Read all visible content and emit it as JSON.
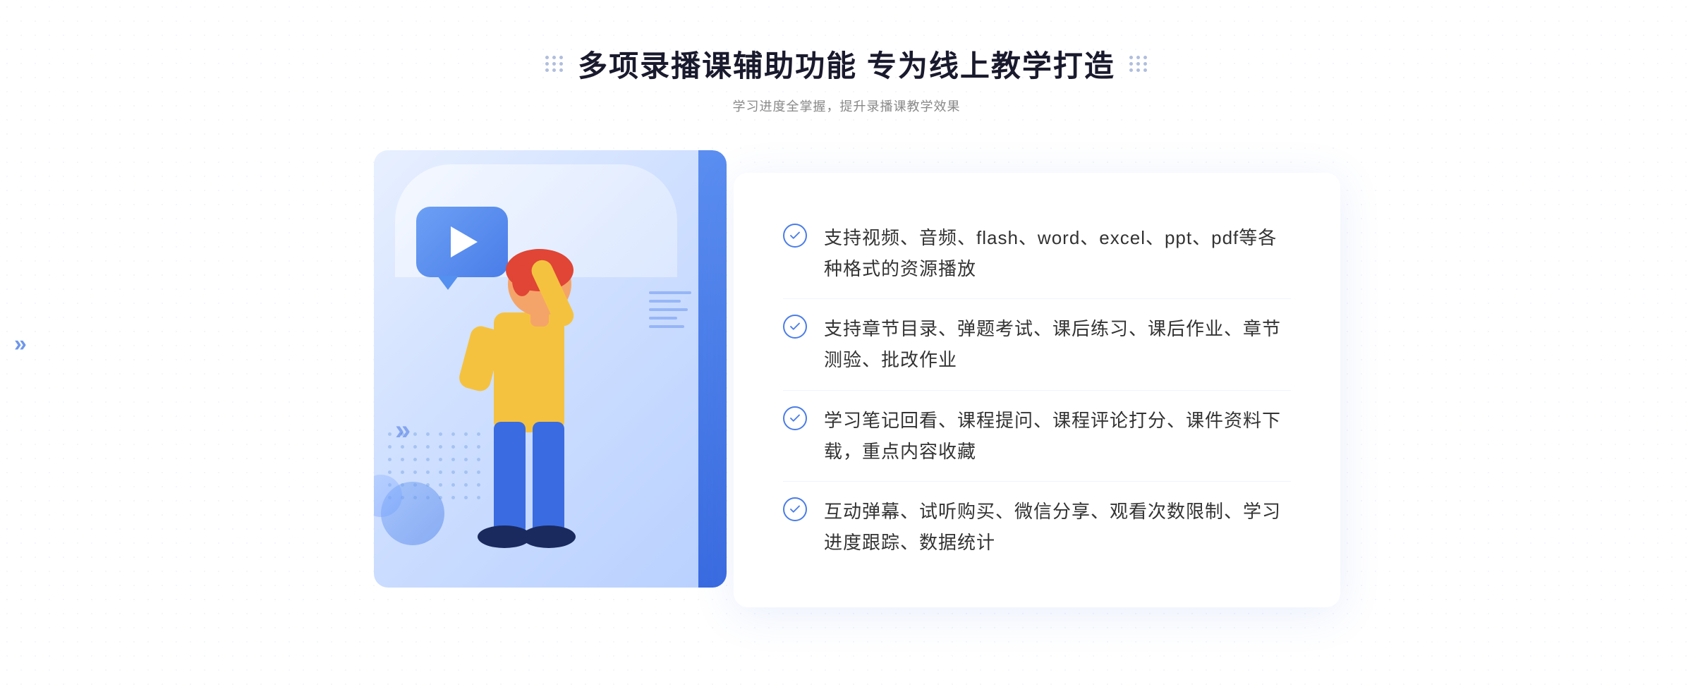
{
  "header": {
    "main_title": "多项录播课辅助功能 专为线上教学打造",
    "sub_title": "学习进度全掌握，提升录播课教学效果"
  },
  "features": [
    {
      "id": 1,
      "text": "支持视频、音频、flash、word、excel、ppt、pdf等各种格式的资源播放"
    },
    {
      "id": 2,
      "text": "支持章节目录、弹题考试、课后练习、课后作业、章节测验、批改作业"
    },
    {
      "id": 3,
      "text": "学习笔记回看、课程提问、课程评论打分、课件资料下载，重点内容收藏"
    },
    {
      "id": 4,
      "text": "互动弹幕、试听购买、微信分享、观看次数限制、学习进度跟踪、数据统计"
    }
  ],
  "decoration": {
    "chevron": "»",
    "play_icon": "▶"
  }
}
